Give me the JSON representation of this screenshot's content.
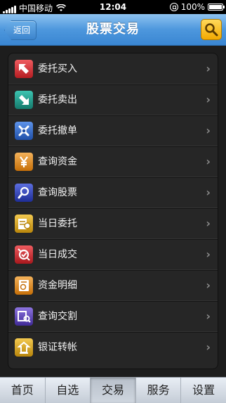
{
  "status": {
    "carrier": "中国移动",
    "time": "12:04",
    "battery": "100%"
  },
  "navbar": {
    "back_label": "返回",
    "title": "股票交易"
  },
  "menu": [
    {
      "label": "委托买入",
      "icon": "buy-arrow-icon",
      "color": "#c8272c"
    },
    {
      "label": "委托卖出",
      "icon": "sell-arrow-icon",
      "color": "#1f9a8a"
    },
    {
      "label": "委托撤单",
      "icon": "cancel-order-icon",
      "color": "#2f67c8"
    },
    {
      "label": "查询资金",
      "icon": "yen-icon",
      "color": "#e08c1a"
    },
    {
      "label": "查询股票",
      "icon": "search-stock-icon",
      "color": "#3245b8"
    },
    {
      "label": "当日委托",
      "icon": "today-order-icon",
      "color": "#d7a21c"
    },
    {
      "label": "当日成交",
      "icon": "today-deal-icon",
      "color": "#c8272c"
    },
    {
      "label": "资金明细",
      "icon": "fund-detail-icon",
      "color": "#e08c1a"
    },
    {
      "label": "查询交割",
      "icon": "delivery-query-icon",
      "color": "#5a3fb0"
    },
    {
      "label": "银证转帐",
      "icon": "bank-transfer-icon",
      "color": "#d7a21c"
    }
  ],
  "tabs": [
    {
      "label": "首页",
      "active": false
    },
    {
      "label": "自选",
      "active": false
    },
    {
      "label": "交易",
      "active": true
    },
    {
      "label": "服务",
      "active": false
    },
    {
      "label": "设置",
      "active": false
    }
  ]
}
